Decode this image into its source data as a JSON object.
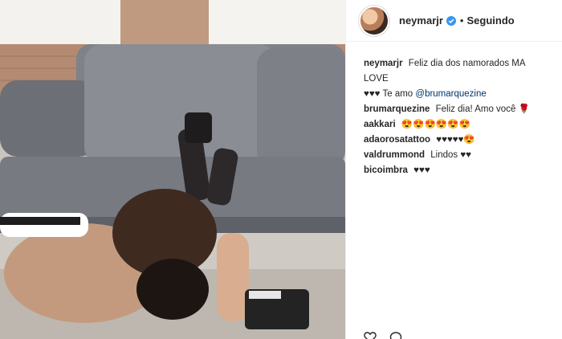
{
  "photo": {
    "icon": "photo-image"
  },
  "header": {
    "username": "neymarjr",
    "separator": "•",
    "follow_status": "Seguindo",
    "verified_icon": "verified-badge-icon"
  },
  "caption": {
    "user": "neymarjr",
    "line1": "Feliz dia dos namorados MA LOVE",
    "line2_prefix": "♥♥♥ Te amo",
    "mention": "@brumarquezine"
  },
  "comments": [
    {
      "user": "brumarquezine",
      "text": "Feliz dia! Amo você 🌹"
    },
    {
      "user": "aakkari",
      "text": "😍😍😍😍😍😍"
    },
    {
      "user": "adaorosatattoo",
      "text": "♥♥♥♥♥😍"
    },
    {
      "user": "valdrummond",
      "text": "Lindos ♥♥"
    },
    {
      "user": "bicoimbra",
      "text": "♥♥♥"
    }
  ],
  "actions": [
    "heart-icon",
    "comment-icon"
  ]
}
